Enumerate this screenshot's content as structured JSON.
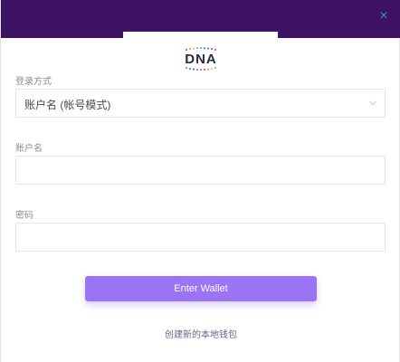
{
  "window": {
    "close_glyph": "×",
    "logo_text": "DNA"
  },
  "form": {
    "login_method_label": "登录方式",
    "login_method_value": "账户名 (帐号模式)",
    "account_label": "账户名",
    "account_value": "",
    "password_label": "密码",
    "password_value": ""
  },
  "actions": {
    "enter_wallet": "Enter Wallet",
    "create_wallet": "创建新的本地钱包"
  },
  "colors": {
    "header": "#3d1263",
    "accent_button": "#9a74f4",
    "close_icon": "#3b8ddb"
  }
}
